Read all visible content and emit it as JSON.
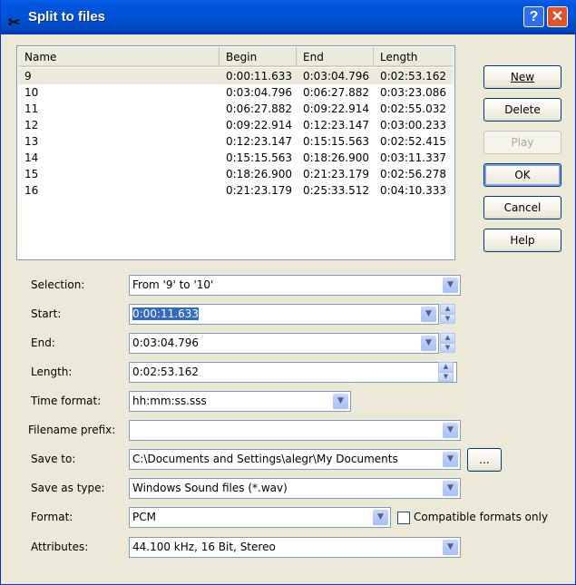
{
  "title": "Split to files",
  "title_buttons": {
    "help": "?",
    "close": "✕"
  },
  "list": {
    "columns": [
      "Name",
      "Begin",
      "End",
      "Length"
    ],
    "rows": [
      [
        "9",
        "0:00:11.633",
        "0:03:04.796",
        "0:02:53.162"
      ],
      [
        "10",
        "0:03:04.796",
        "0:06:27.882",
        "0:03:23.086"
      ],
      [
        "11",
        "0:06:27.882",
        "0:09:22.914",
        "0:02:55.032"
      ],
      [
        "12",
        "0:09:22.914",
        "0:12:23.147",
        "0:03:00.233"
      ],
      [
        "13",
        "0:12:23.147",
        "0:15:15.563",
        "0:02:52.415"
      ],
      [
        "14",
        "0:15:15.563",
        "0:18:26.900",
        "0:03:11.337"
      ],
      [
        "15",
        "0:18:26.900",
        "0:21:23.179",
        "0:02:56.278"
      ],
      [
        "16",
        "0:21:23.179",
        "0:25:33.512",
        "0:04:10.333"
      ]
    ]
  },
  "buttons": {
    "new": "New",
    "delete": "Delete",
    "play": "Play",
    "ok": "OK",
    "cancel": "Cancel",
    "help": "Help",
    "browse": "..."
  },
  "form": {
    "selection": {
      "label": "Selection:",
      "value": "From '9' to '10'"
    },
    "start": {
      "label": "Start:",
      "value": "0:00:11.633"
    },
    "end": {
      "label": "End:",
      "value": "0:03:04.796"
    },
    "length": {
      "label": "Length:",
      "value": "0:02:53.162"
    },
    "time_format": {
      "label": "Time format:",
      "value": "hh:mm:ss.sss"
    },
    "filename_prefix": {
      "label": "Filename prefix:",
      "value": ""
    },
    "save_to": {
      "label": "Save to:",
      "value": "C:\\Documents and Settings\\alegr\\My Documents"
    },
    "save_as_type": {
      "label": "Save as type:",
      "value": "Windows Sound files (*.wav)"
    },
    "format": {
      "label": "Format:",
      "value": "PCM"
    },
    "compatible": {
      "label": "Compatible formats only",
      "checked": false
    },
    "attributes": {
      "label": "Attributes:",
      "value": "44.100 kHz, 16 Bit, Stereo"
    }
  }
}
